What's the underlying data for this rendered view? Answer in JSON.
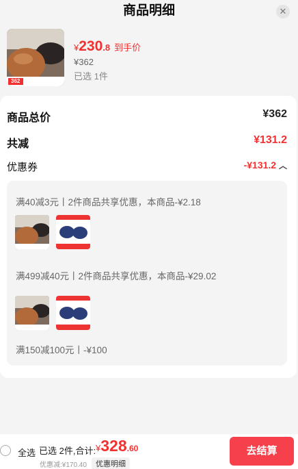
{
  "header": {
    "title": "商品明细",
    "close_icon": "close-icon"
  },
  "product": {
    "price_yen": "¥",
    "price_int": "230",
    "price_dec": ".8",
    "price_tag": "到手价",
    "original_price": "¥362",
    "selected": "已选 1件",
    "thumb_badge": "362"
  },
  "summary": {
    "total_label": "商品总价",
    "total_value": "¥362",
    "reduce_label": "共减",
    "reduce_value": "¥131.2",
    "coupon_label": "优惠券",
    "coupon_value": "-¥131.2",
    "coupon_icon": "chevron-up-icon"
  },
  "coupons": [
    {
      "text": "满40减3元丨2件商品共享优惠，本商品-¥2.18"
    },
    {
      "text": "满499减40元丨2件商品共享优惠，本商品-¥29.02"
    },
    {
      "text": "满150减100元丨-¥100"
    }
  ],
  "footer": {
    "select_all": "全选",
    "summary_text": "已选 2件,合计:",
    "total_yen": "¥",
    "total_int": "328",
    "total_dec": ".60",
    "discount_text": "优惠减:¥170.40",
    "detail_link": "优惠明细",
    "checkout_label": "去结算"
  },
  "colors": {
    "accent": "#f23030",
    "checkout": "#f6404b"
  }
}
